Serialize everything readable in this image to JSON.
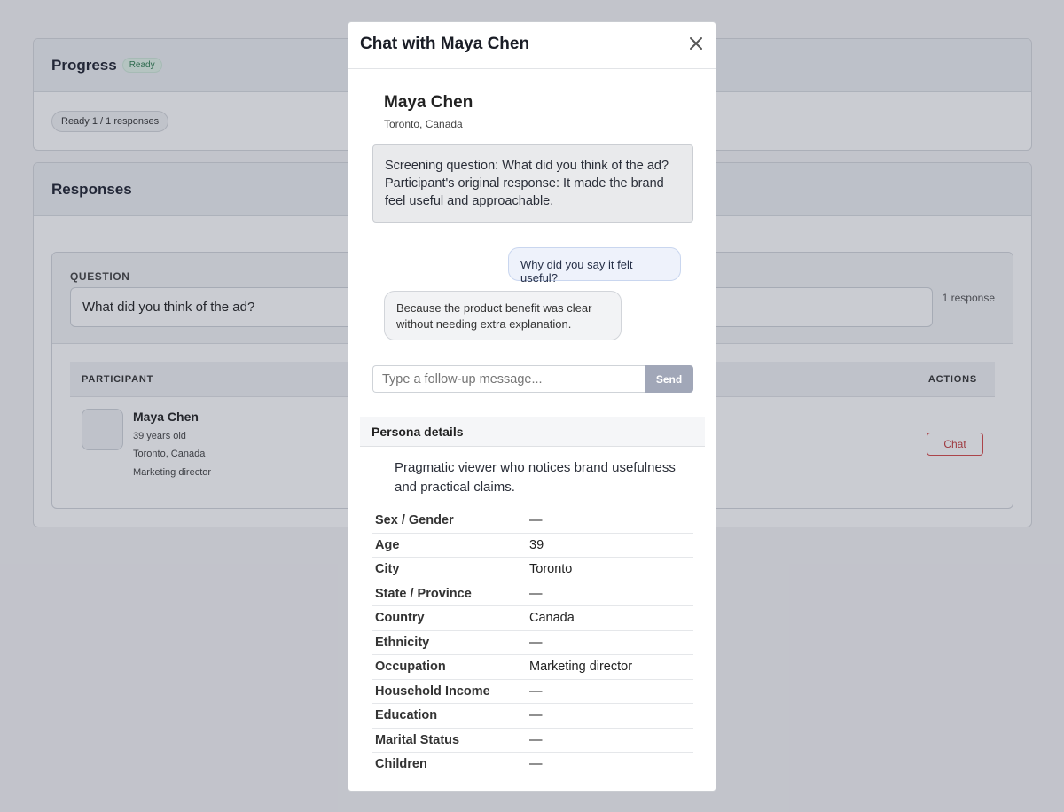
{
  "progress_card": {
    "title": "Progress",
    "badge": "Ready",
    "status_pill": "Ready 1 / 1 responses"
  },
  "responses_card": {
    "title": "Responses",
    "question_label": "QUESTION",
    "question_text": "What did you think of the ad?",
    "response_count": "1 response",
    "table_headers": {
      "participant": "PARTICIPANT",
      "actions": "ACTIONS"
    },
    "participant": {
      "name": "Maya Chen",
      "age": "39 years old",
      "location": "Toronto, Canada",
      "occupation": "Marketing director"
    },
    "chat_button": "Chat"
  },
  "modal": {
    "title": "Chat with Maya Chen",
    "name": "Maya Chen",
    "location": "Toronto, Canada",
    "screening": "Screening question: What did you think of the ad? Participant's original response: It made the brand feel useful and approachable.",
    "messages": [
      {
        "role": "user",
        "text": "Why did you say it felt useful?"
      },
      {
        "role": "persona",
        "text": "Because the product benefit was clear without needing extra explanation."
      }
    ],
    "input_placeholder": "Type a follow-up message...",
    "send_label": "Send",
    "persona_heading": "Persona details",
    "persona_description": "Pragmatic viewer who notices brand usefulness and practical claims.",
    "details": [
      {
        "label": "Sex / Gender",
        "value": "—"
      },
      {
        "label": "Age",
        "value": "39"
      },
      {
        "label": "City",
        "value": "Toronto"
      },
      {
        "label": "State / Province",
        "value": "—"
      },
      {
        "label": "Country",
        "value": "Canada"
      },
      {
        "label": "Ethnicity",
        "value": "—"
      },
      {
        "label": "Occupation",
        "value": "Marketing director"
      },
      {
        "label": "Household Income",
        "value": "—"
      },
      {
        "label": "Education",
        "value": "—"
      },
      {
        "label": "Marital Status",
        "value": "—"
      },
      {
        "label": "Children",
        "value": "—"
      }
    ]
  },
  "colors": {
    "accent_red": "#d64a4a",
    "send_button": "#a1a7b8",
    "badge_green": "#2f7d4f"
  }
}
